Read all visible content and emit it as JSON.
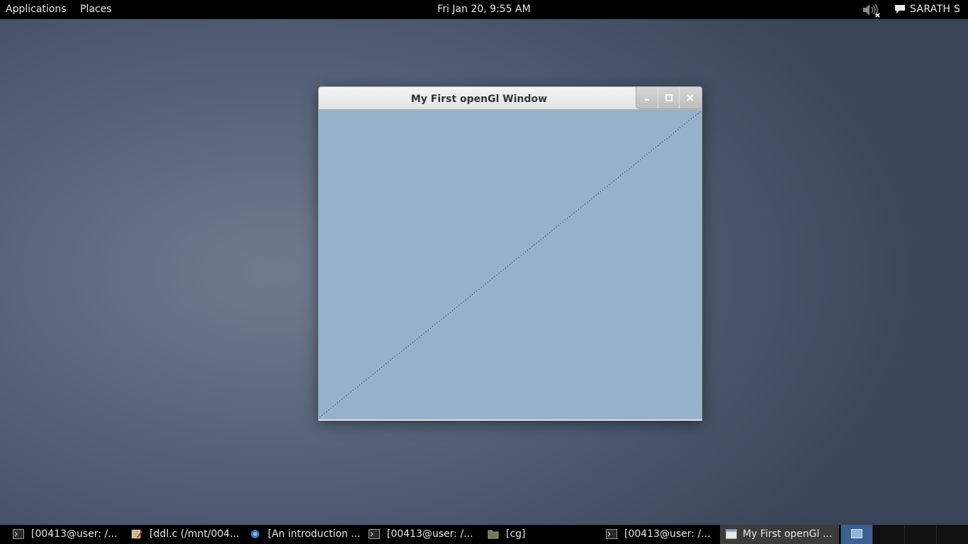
{
  "topbar": {
    "applications": "Applications",
    "places": "Places",
    "clock": "Fri Jan 20,  9:55 AM",
    "user": "SARATH S",
    "icons": [
      "volume-muted-icon",
      "chat-icon"
    ]
  },
  "window": {
    "title": "My First openGl Window",
    "buttons": [
      "minimize",
      "maximize",
      "close"
    ],
    "canvas_color": "#98b1ca",
    "line": "dotted diagonal from bottom-left to top-right"
  },
  "taskbar": {
    "items": [
      {
        "label": "[00413@user: /...",
        "icon": "terminal-icon",
        "active": false
      },
      {
        "label": "[ddl.c (/mnt/004...",
        "icon": "text-editor-icon",
        "active": false
      },
      {
        "label": "[An introduction ...",
        "icon": "browser-icon",
        "active": false
      },
      {
        "label": "[00413@user: /...",
        "icon": "terminal-icon",
        "active": false
      },
      {
        "label": "[cg]",
        "icon": "folder-icon",
        "active": false
      },
      {
        "label": "[00413@user: /...",
        "icon": "terminal-icon",
        "active": false
      },
      {
        "label": "My First openGl ...",
        "icon": "window-icon",
        "active": true
      }
    ],
    "workspaces": 4,
    "active_workspace": 1
  }
}
